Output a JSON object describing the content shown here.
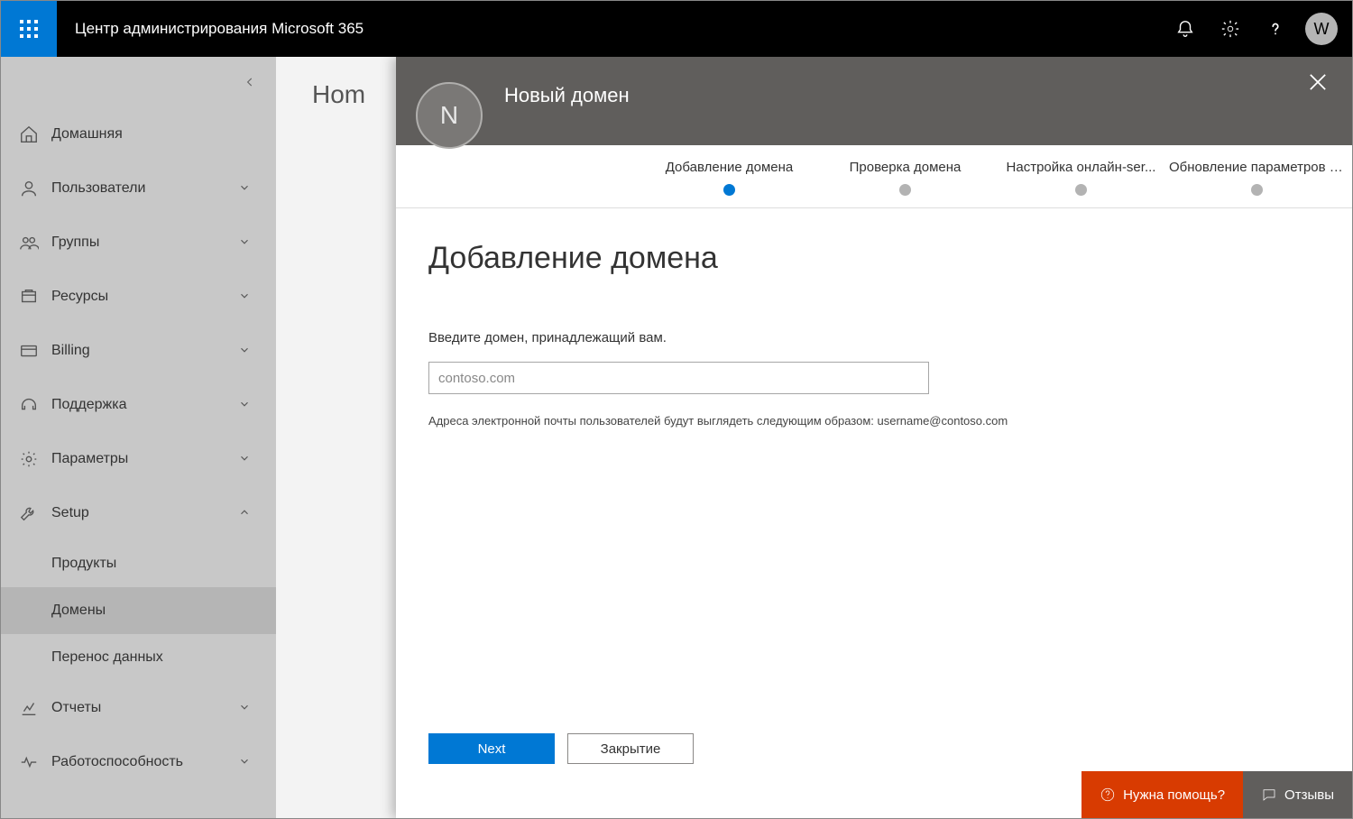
{
  "topbar": {
    "title": "Центр администрирования Microsoft 365",
    "avatar_letter": "W"
  },
  "sidebar": {
    "items": [
      {
        "label": "Домашняя",
        "icon": "home",
        "expandable": false
      },
      {
        "label": "Пользователи",
        "icon": "user",
        "expandable": true
      },
      {
        "label": "Группы",
        "icon": "groups",
        "expandable": true
      },
      {
        "label": "Ресурсы",
        "icon": "resources",
        "expandable": true
      },
      {
        "label": "Billing",
        "icon": "billing",
        "expandable": true
      },
      {
        "label": "Поддержка",
        "icon": "support",
        "expandable": true
      },
      {
        "label": "Параметры",
        "icon": "settings",
        "expandable": true
      },
      {
        "label": "Setup",
        "icon": "setup",
        "expandable": true,
        "expanded": true,
        "children": [
          {
            "label": "Продукты",
            "active": false
          },
          {
            "label": "Домены",
            "active": true
          },
          {
            "label": "Перенос данных",
            "active": false
          }
        ]
      },
      {
        "label": "Отчеты",
        "icon": "reports",
        "expandable": true
      },
      {
        "label": "Работоспособность",
        "icon": "health",
        "expandable": true
      }
    ]
  },
  "content": {
    "breadcrumb": "Hom"
  },
  "panel": {
    "avatar_letter": "N",
    "title": "Новый домен",
    "steps": [
      {
        "label": "Добавление домена",
        "active": true
      },
      {
        "label": "Проверка домена",
        "active": false
      },
      {
        "label": "Настройка онлайн-ser...",
        "active": false
      },
      {
        "label": "Обновление параметров DNS",
        "active": false
      }
    ],
    "heading": "Добавление домена",
    "field_label": "Введите домен, принадлежащий вам.",
    "input_placeholder": "contoso.com",
    "input_value": "",
    "hint": "Адреса электронной почты пользователей будут выглядеть следующим образом: username@contoso.com",
    "buttons": {
      "primary": "Next",
      "secondary": "Закрытие"
    }
  },
  "bottom": {
    "help": "Нужна помощь?",
    "feedback": "Отзывы"
  }
}
